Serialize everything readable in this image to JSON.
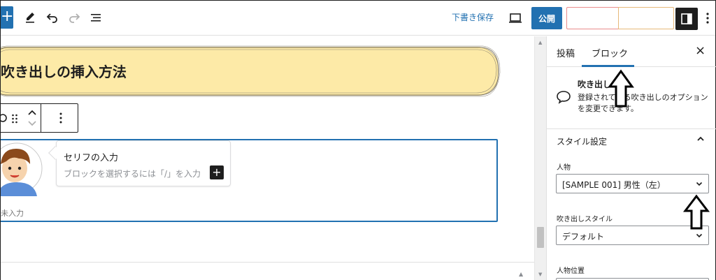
{
  "toolbar": {
    "add_label": "+",
    "draft_save_label": "下書き保存",
    "publish_label": "公開",
    "icons": [
      "add-block-icon",
      "pencil-icon",
      "undo-icon",
      "redo-icon",
      "list-view-icon",
      "preview-icon",
      "settings-icon",
      "more-options-icon"
    ]
  },
  "editor": {
    "heading": "吹き出しの挿入方法",
    "balloon": {
      "speech_text": "セリフの入力",
      "placeholder": "ブロックを選択するには「/」を入力",
      "speaker_name": "未入力",
      "add_label": "+"
    }
  },
  "sidebar": {
    "tabs": [
      {
        "label": "投稿"
      },
      {
        "label": "ブロック"
      }
    ],
    "active_tab": 1,
    "close_label": "×",
    "block_card": {
      "title": "吹き出し",
      "description": "登録されている吹き出しのオプションを変更できます。"
    },
    "panel_title": "スタイル設定",
    "fields": [
      {
        "label": "人物",
        "value": "[SAMPLE 001] 男性（左）"
      },
      {
        "label": "吹き出しスタイル",
        "value": "デフォルト"
      },
      {
        "label": "人物位置"
      }
    ]
  },
  "colors": {
    "accent": "#2271b1",
    "heading_bg": "#fdeaa7",
    "dark": "#1e1e1e"
  }
}
